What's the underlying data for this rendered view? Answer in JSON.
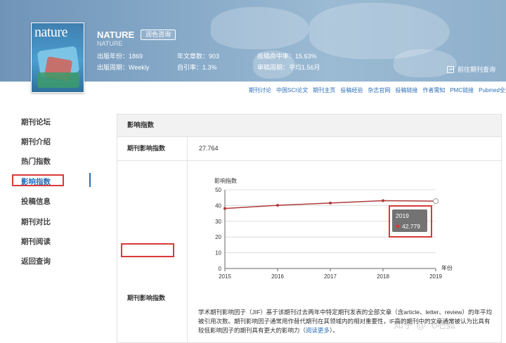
{
  "journal": {
    "cover_logo": "nature",
    "name": "NATURE",
    "subname": "NATURE",
    "quick_query_label": "润色咨询",
    "founded": "出版年份：1869",
    "articles_per_year": "年文章数：903",
    "hit_rate": "投稿命中率：15.63%",
    "frequency": "出版周期：Weekly",
    "self_cite": "自引率：1.3%",
    "review_cycle": "审稿周期：平均1.56月",
    "goto_label": "前往期刊查询"
  },
  "links": [
    "期刊讨论",
    "中国SCI论文",
    "期刊主页",
    "投稿经验",
    "杂志官网",
    "投稿链接",
    "作者需知",
    "PMC链接",
    "Pubmed全文检索"
  ],
  "sidebar": {
    "items": [
      {
        "label": "期刊论坛"
      },
      {
        "label": "期刊介绍"
      },
      {
        "label": "热门指数"
      },
      {
        "label": "影响指数"
      },
      {
        "label": "投稿信息"
      },
      {
        "label": "期刊对比"
      },
      {
        "label": "期刊阅读"
      },
      {
        "label": "返回查询"
      }
    ],
    "active_index": 3
  },
  "panel": {
    "title": "影响指数",
    "row1_label": "期刊影响指数",
    "row1_value": "27.764",
    "row2_label": "期刊影响指数",
    "description": "学术期刊影响因子（JIF）基于该期刊过去两年中特定期刊发表的全部文章（含article、letter、review）的年平均被引用次数。期刊影响因子通常用作替代期刊在其领域内的相对重要性，IF高的期刊中的文章通常被认为比具有较低影响因子的期刊具有更大的影响力（",
    "read_more": "阅读更多",
    "description_end": "）。"
  },
  "chart_data": {
    "type": "line",
    "ylabel": "影响指数",
    "xlabel": "年份",
    "x": [
      "2015",
      "2016",
      "2017",
      "2018",
      "2019"
    ],
    "series": [
      {
        "values": [
          38.138,
          40.137,
          41.577,
          43.07,
          42.779
        ],
        "color": "#b03a3a"
      }
    ],
    "ylim": [
      0,
      50
    ],
    "yticks": [
      0,
      10,
      20,
      30,
      40,
      50
    ],
    "grid": true,
    "tooltip": {
      "year": "2019",
      "value": "42.779"
    }
  },
  "watermark": "知乎 @飞吧狐"
}
